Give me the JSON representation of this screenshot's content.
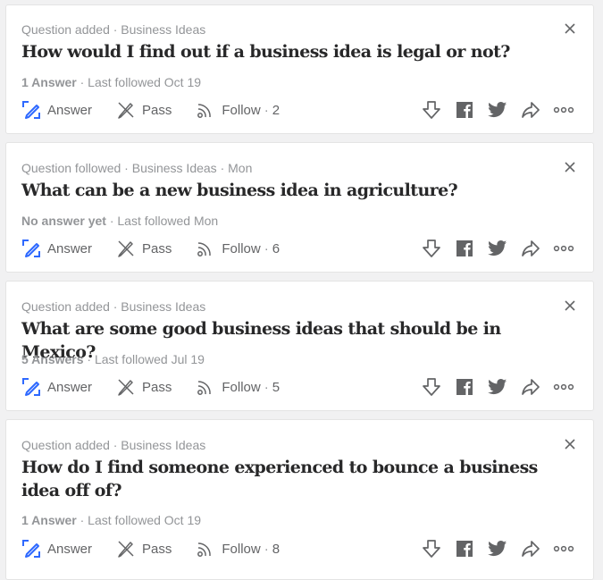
{
  "colors": {
    "answer_accent": "#2e69ff",
    "meta_text": "#939598",
    "title_text": "#282829",
    "action_text": "#636466",
    "icon_gray": "#636466"
  },
  "feed": [
    {
      "meta": "Question added · Business Ideas",
      "title": "How would I find out if a business idea is legal or not?",
      "answer_count": "1 Answer",
      "last_followed": " · Last followed Oct 19",
      "actions": {
        "answer": "Answer",
        "pass": "Pass",
        "follow": "Follow",
        "follow_count": "2"
      },
      "icons": [
        "downvote-icon",
        "facebook-icon",
        "twitter-icon",
        "share-icon",
        "more-icon"
      ]
    },
    {
      "meta": "Question followed · Business Ideas · Mon",
      "title": "What can be a new business idea in agriculture?",
      "answer_count": "No answer yet",
      "last_followed": " · Last followed Mon",
      "actions": {
        "answer": "Answer",
        "pass": "Pass",
        "follow": "Follow",
        "follow_count": "6"
      },
      "icons": [
        "downvote-icon",
        "facebook-icon",
        "twitter-icon",
        "share-icon",
        "more-icon"
      ]
    },
    {
      "meta": "Question added · Business Ideas",
      "title": "What are some good business ideas that should be in Mexico?",
      "answer_count": "5 Answers",
      "last_followed": " · Last followed Jul 19",
      "actions": {
        "answer": "Answer",
        "pass": "Pass",
        "follow": "Follow",
        "follow_count": "5"
      },
      "icons": [
        "downvote-icon",
        "facebook-icon",
        "twitter-icon",
        "share-icon",
        "more-icon"
      ]
    },
    {
      "meta": "Question added · Business Ideas",
      "title": "How do I find someone experienced to bounce a business idea off of?",
      "answer_count": "1 Answer",
      "last_followed": " · Last followed Oct 19",
      "actions": {
        "answer": "Answer",
        "pass": "Pass",
        "follow": "Follow",
        "follow_count": "8"
      },
      "icons": [
        "downvote-icon",
        "facebook-icon",
        "twitter-icon",
        "share-icon",
        "more-icon"
      ]
    }
  ]
}
